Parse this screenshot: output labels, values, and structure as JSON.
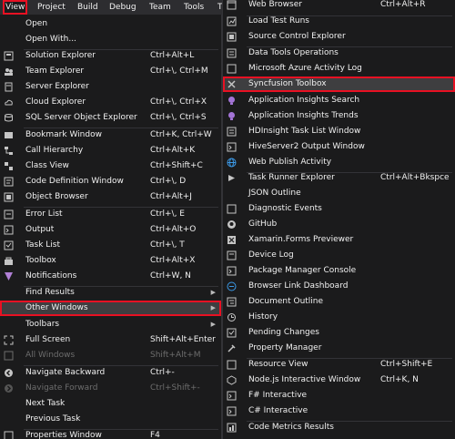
{
  "menubar": {
    "items": [
      "View",
      "Project",
      "Build",
      "Debug",
      "Team",
      "Tools",
      "T"
    ]
  },
  "view_menu": {
    "items": [
      {
        "label": "Open",
        "shortcut": "",
        "icon": "none"
      },
      {
        "label": "Open With...",
        "shortcut": "",
        "icon": "none"
      },
      {
        "label": "Solution Explorer",
        "shortcut": "Ctrl+Alt+L",
        "icon": "solution-explorer-icon"
      },
      {
        "label": "Team Explorer",
        "shortcut": "Ctrl+\\, Ctrl+M",
        "icon": "team-explorer-icon"
      },
      {
        "label": "Server Explorer",
        "shortcut": "",
        "icon": "server-explorer-icon"
      },
      {
        "label": "Cloud Explorer",
        "shortcut": "Ctrl+\\, Ctrl+X",
        "icon": "cloud-icon"
      },
      {
        "label": "SQL Server Object Explorer",
        "shortcut": "Ctrl+\\, Ctrl+S",
        "icon": "sql-server-icon"
      },
      {
        "label": "Bookmark Window",
        "shortcut": "Ctrl+K, Ctrl+W",
        "icon": "bookmark-icon"
      },
      {
        "label": "Call Hierarchy",
        "shortcut": "Ctrl+Alt+K",
        "icon": "call-hierarchy-icon"
      },
      {
        "label": "Class View",
        "shortcut": "Ctrl+Shift+C",
        "icon": "class-view-icon"
      },
      {
        "label": "Code Definition Window",
        "shortcut": "Ctrl+\\, D",
        "icon": "code-definition-icon"
      },
      {
        "label": "Object Browser",
        "shortcut": "Ctrl+Alt+J",
        "icon": "object-browser-icon"
      },
      {
        "label": "Error List",
        "shortcut": "Ctrl+\\, E",
        "icon": "error-list-icon"
      },
      {
        "label": "Output",
        "shortcut": "Ctrl+Alt+O",
        "icon": "output-icon"
      },
      {
        "label": "Task List",
        "shortcut": "Ctrl+\\, T",
        "icon": "task-list-icon"
      },
      {
        "label": "Toolbox",
        "shortcut": "Ctrl+Alt+X",
        "icon": "toolbox-icon"
      },
      {
        "label": "Notifications",
        "shortcut": "Ctrl+W, N",
        "icon": "notifications-icon"
      },
      {
        "label": "Find Results",
        "shortcut": "",
        "icon": "none"
      },
      {
        "label": "Other Windows",
        "shortcut": "",
        "icon": "none"
      },
      {
        "label": "Toolbars",
        "shortcut": "",
        "icon": "none"
      },
      {
        "label": "Full Screen",
        "shortcut": "Shift+Alt+Enter",
        "icon": "full-screen-icon"
      },
      {
        "label": "All Windows",
        "shortcut": "Shift+Alt+M",
        "icon": "all-windows-icon"
      },
      {
        "label": "Navigate Backward",
        "shortcut": "Ctrl+-",
        "icon": "navigate-backward-icon"
      },
      {
        "label": "Navigate Forward",
        "shortcut": "Ctrl+Shift+-",
        "icon": "navigate-forward-icon"
      },
      {
        "label": "Next Task",
        "shortcut": "",
        "icon": "none"
      },
      {
        "label": "Previous Task",
        "shortcut": "",
        "icon": "none"
      },
      {
        "label": "Properties Window",
        "shortcut": "F4",
        "icon": "properties-icon"
      }
    ]
  },
  "other_windows_menu": {
    "items": [
      {
        "label": "Web Browser",
        "shortcut": "Ctrl+Alt+R",
        "icon": "web-browser-icon"
      },
      {
        "label": "Load Test Runs",
        "shortcut": "",
        "icon": "load-test-icon"
      },
      {
        "label": "Source Control Explorer",
        "shortcut": "",
        "icon": "source-control-icon"
      },
      {
        "label": "Data Tools Operations",
        "shortcut": "",
        "icon": "data-tools-icon"
      },
      {
        "label": "Microsoft Azure Activity Log",
        "shortcut": "",
        "icon": "azure-activity-icon"
      },
      {
        "label": "Syncfusion Toolbox",
        "shortcut": "",
        "icon": "syncfusion-icon"
      },
      {
        "label": "Application Insights Search",
        "shortcut": "",
        "icon": "app-insights-search-icon"
      },
      {
        "label": "Application Insights Trends",
        "shortcut": "",
        "icon": "app-insights-trends-icon"
      },
      {
        "label": "HDInsight Task List Window",
        "shortcut": "",
        "icon": "hdinsight-icon"
      },
      {
        "label": "HiveServer2 Output Window",
        "shortcut": "",
        "icon": "hiveserver-icon"
      },
      {
        "label": "Web Publish Activity",
        "shortcut": "",
        "icon": "web-publish-icon"
      },
      {
        "label": "Task Runner Explorer",
        "shortcut": "Ctrl+Alt+Bkspce",
        "icon": "task-runner-icon"
      },
      {
        "label": "JSON Outline",
        "shortcut": "",
        "icon": "none"
      },
      {
        "label": "Diagnostic Events",
        "shortcut": "",
        "icon": "diagnostic-events-icon"
      },
      {
        "label": "GitHub",
        "shortcut": "",
        "icon": "github-icon"
      },
      {
        "label": "Xamarin.Forms Previewer",
        "shortcut": "",
        "icon": "xamarin-icon"
      },
      {
        "label": "Device Log",
        "shortcut": "",
        "icon": "device-log-icon"
      },
      {
        "label": "Package Manager Console",
        "shortcut": "",
        "icon": "package-manager-icon"
      },
      {
        "label": "Browser Link Dashboard",
        "shortcut": "",
        "icon": "browser-link-icon"
      },
      {
        "label": "Document Outline",
        "shortcut": "",
        "icon": "document-outline-icon"
      },
      {
        "label": "History",
        "shortcut": "",
        "icon": "history-icon"
      },
      {
        "label": "Pending Changes",
        "shortcut": "",
        "icon": "pending-changes-icon"
      },
      {
        "label": "Property Manager",
        "shortcut": "",
        "icon": "property-manager-icon"
      },
      {
        "label": "Resource View",
        "shortcut": "Ctrl+Shift+E",
        "icon": "resource-view-icon"
      },
      {
        "label": "Node.js Interactive Window",
        "shortcut": "Ctrl+K, N",
        "icon": "nodejs-icon"
      },
      {
        "label": "F# Interactive",
        "shortcut": "",
        "icon": "fsharp-icon"
      },
      {
        "label": "C# Interactive",
        "shortcut": "",
        "icon": "csharp-icon"
      },
      {
        "label": "Code Metrics Results",
        "shortcut": "",
        "icon": "code-metrics-icon"
      }
    ]
  }
}
